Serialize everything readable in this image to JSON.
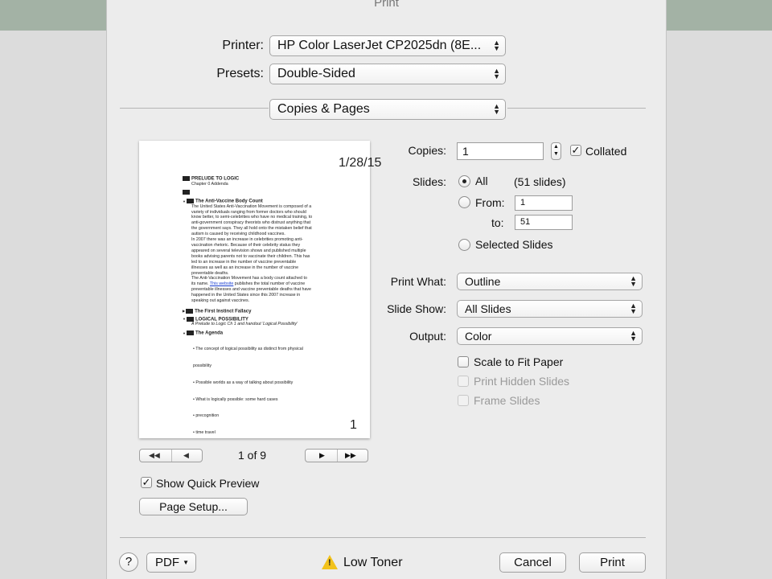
{
  "window": {
    "title": "Print"
  },
  "printer": {
    "label": "Printer:",
    "value": "HP Color LaserJet CP2025dn (8E..."
  },
  "presets": {
    "label": "Presets:",
    "value": "Double-Sided"
  },
  "section": {
    "value": "Copies & Pages"
  },
  "copies": {
    "label": "Copies:",
    "value": "1",
    "collated_label": "Collated",
    "collated": true
  },
  "slides": {
    "label": "Slides:",
    "all_label": "All",
    "count_text": "(51 slides)",
    "from_label": "From:",
    "from_value": "1",
    "to_label": "to:",
    "to_value": "51",
    "selected_label": "Selected Slides",
    "selected_option": "All"
  },
  "print_what": {
    "label": "Print What:",
    "value": "Outline"
  },
  "slide_show": {
    "label": "Slide Show:",
    "value": "All Slides"
  },
  "output": {
    "label": "Output:",
    "value": "Color"
  },
  "options": {
    "scale_label": "Scale to Fit Paper",
    "scale_checked": false,
    "hidden_label": "Print Hidden Slides",
    "hidden_enabled": false,
    "frame_label": "Frame Slides",
    "frame_enabled": false
  },
  "preview_nav": {
    "page_text": "1 of 9"
  },
  "quick_preview": {
    "label": "Show Quick Preview",
    "checked": true
  },
  "page_setup": {
    "label": "Page Setup..."
  },
  "footer": {
    "help_label": "?",
    "pdf_label": "PDF",
    "warning_text": "Low Toner",
    "cancel_label": "Cancel",
    "print_label": "Print"
  },
  "preview_page": {
    "date": "1/28/15",
    "page_number": "1",
    "heading1": "PRELUDE TO LOGIC",
    "heading1_sub": "Chapter 0 Addenda",
    "heading2": "The Anti-Vaccine Body Count",
    "body_lines": [
      "The United States Anti-Vaccination Movement is composed of a",
      "variety of individuals ranging from former doctors who should",
      "know better, to semi-celebrities who have no medical training, to",
      "anti-government conspiracy theorists who distrust anything that",
      "the government says. They all hold onto the mistaken belief that",
      "autism is caused by receiving childhood vaccines.",
      "In 2007 there was an increase in celebrities promoting anti-",
      "vaccination rhetoric. Because of their celebrity status they",
      "appeared on several television shows and published multiple",
      "books advising parents not to vaccinate their children. This has",
      "led to an increase in the number of vaccine preventable",
      "illnesses as well as an increase in the number of vaccine",
      "preventable deaths.",
      "The Anti-Vaccination Movement has a body count attached to"
    ],
    "link_line_prefix": "its name. ",
    "link_text": "This website",
    "link_line_suffix": " publishes the total number of vaccine",
    "body_lines_2": [
      "preventable illnesses and vaccine preventable deaths that have",
      "happened in the United States since this 2007 increase in",
      "speaking out against vaccines."
    ],
    "heading3": "The First Instinct Fallacy",
    "heading4": "LOGICAL POSSIBILITY",
    "heading4_sub": "A Prelude to Logic Ch 1 and handout 'Logical Possibility'",
    "heading5": "The Agenda",
    "agenda": [
      "• The concept of logical possibility as distinct from physical",
      "   possibility",
      "• Possible worlds as a way of talking about possibility",
      "  • What is logically possible: some hard cases",
      "    • precognition",
      "    • time travel"
    ]
  },
  "colors": {
    "background_bar": "#a3b2a5",
    "dialog": "#ececec",
    "warning": "#f2c21b",
    "link": "#1a3fd1"
  }
}
